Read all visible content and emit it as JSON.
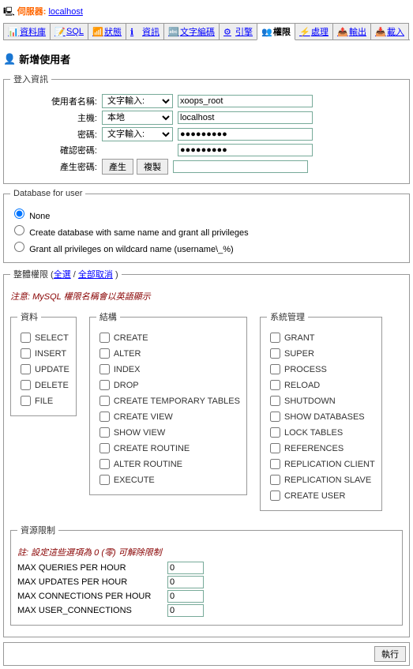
{
  "server": {
    "label": "伺服器:",
    "name": "localhost"
  },
  "tabs": [
    "資料庫",
    "SQL",
    "狀態",
    "資訊",
    "文字編碼",
    "引擎",
    "權限",
    "處理",
    "輸出",
    "載入"
  ],
  "active_tab": "權限",
  "page_title": "新增使用者",
  "login_box": {
    "legend": "登入資訊",
    "username_label": "使用者名稱:",
    "username_mode": "文字輸入:",
    "username_value": "xoops_root",
    "host_label": "主機:",
    "host_mode": "本地",
    "host_value": "localhost",
    "password_label": "密碼:",
    "password_mode": "文字輸入:",
    "password_value": "●●●●●●●●●",
    "confirm_label": "確認密碼:",
    "confirm_value": "●●●●●●●●●",
    "gen_label": "產生密碼:",
    "gen_btn": "產生",
    "copy_btn": "複製"
  },
  "db_box": {
    "legend": "Database for user",
    "opt_none": "None",
    "opt_create": "Create database with same name and grant all privileges",
    "opt_wildcard": "Grant all privileges on wildcard name (username\\_%)"
  },
  "priv_box": {
    "legend_prefix": "整體權限 (",
    "select_all": "全選",
    "sep": " / ",
    "deselect_all": "全部取消",
    "legend_suffix": " )",
    "note": "注意: MySQL 權限名稱會以英語顯示",
    "data_legend": "資料",
    "data": [
      "SELECT",
      "INSERT",
      "UPDATE",
      "DELETE",
      "FILE"
    ],
    "struct_legend": "結構",
    "struct": [
      "CREATE",
      "ALTER",
      "INDEX",
      "DROP",
      "CREATE TEMPORARY TABLES",
      "CREATE VIEW",
      "SHOW VIEW",
      "CREATE ROUTINE",
      "ALTER ROUTINE",
      "EXECUTE"
    ],
    "admin_legend": "系統管理",
    "admin": [
      "GRANT",
      "SUPER",
      "PROCESS",
      "RELOAD",
      "SHUTDOWN",
      "SHOW DATABASES",
      "LOCK TABLES",
      "REFERENCES",
      "REPLICATION CLIENT",
      "REPLICATION SLAVE",
      "CREATE USER"
    ]
  },
  "limits": {
    "legend": "資源限制",
    "note": "註: 設定這些選項為 0 (零) 可解除限制",
    "rows": [
      {
        "label": "MAX QUERIES PER HOUR",
        "value": "0"
      },
      {
        "label": "MAX UPDATES PER HOUR",
        "value": "0"
      },
      {
        "label": "MAX CONNECTIONS PER HOUR",
        "value": "0"
      },
      {
        "label": "MAX USER_CONNECTIONS",
        "value": "0"
      }
    ]
  },
  "go_button": "執行"
}
